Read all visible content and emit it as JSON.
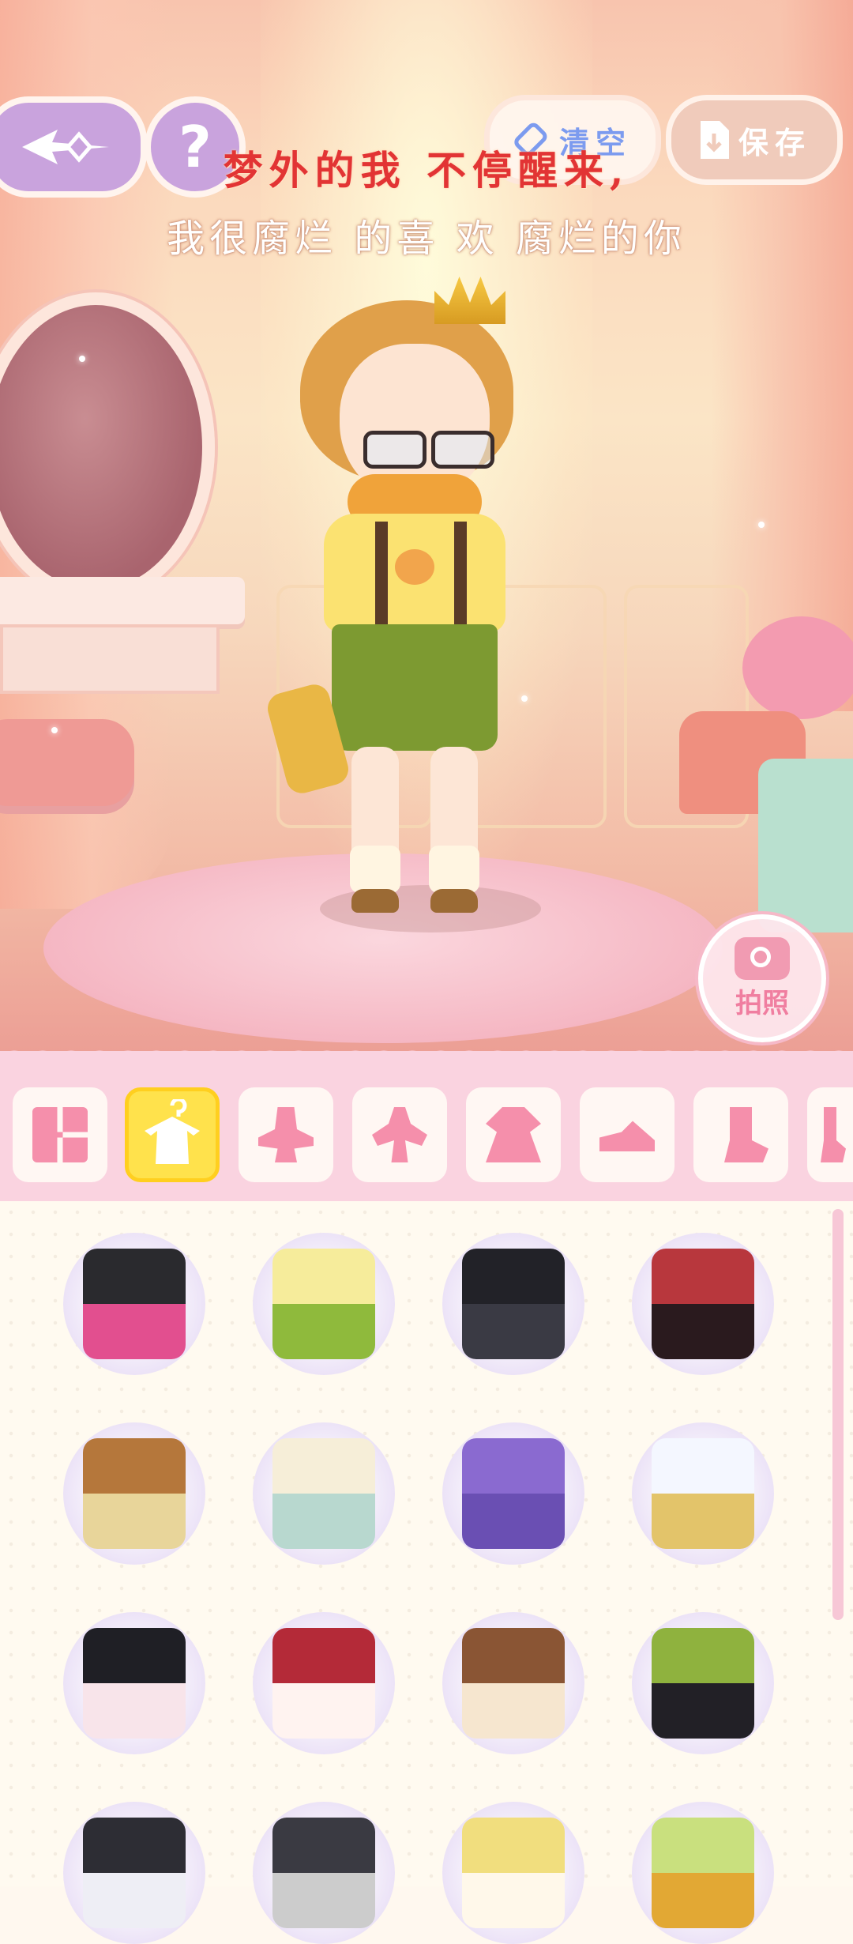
{
  "top_bar": {
    "clear_label": "清空",
    "save_label": "保存",
    "back_icon": "back-arrow-icon",
    "help_icon": "question-icon",
    "help_glyph": "?"
  },
  "lyrics": {
    "line1": "梦外的我 不停醒来,",
    "line2": "我很腐烂 的喜 欢 腐烂的你"
  },
  "photo_button": {
    "label": "拍照",
    "icon": "camera-icon"
  },
  "tabs": [
    {
      "name": "all",
      "icon": "grid-icon",
      "active": false
    },
    {
      "name": "outfit",
      "icon": "outfit-icon",
      "active": true
    },
    {
      "name": "headwear",
      "icon": "hat-icon",
      "active": false
    },
    {
      "name": "top",
      "icon": "top-icon",
      "active": false
    },
    {
      "name": "dress",
      "icon": "dress-icon",
      "active": false
    },
    {
      "name": "shoes",
      "icon": "shoe-icon",
      "active": false
    },
    {
      "name": "socks",
      "icon": "sock-icon",
      "active": false
    },
    {
      "name": "more",
      "icon": "glove-icon",
      "active": false
    }
  ],
  "outfits": [
    {
      "name": "black-pink-checker-outfit",
      "colors": [
        "#2a2a2e",
        "#e24f8f"
      ]
    },
    {
      "name": "yellow-green-checker-outfit",
      "colors": [
        "#f6ec9b",
        "#8fba3c"
      ]
    },
    {
      "name": "black-double-breasted-coat",
      "colors": [
        "#222228",
        "#3a3a44"
      ]
    },
    {
      "name": "vampire-red-vest-outfit",
      "colors": [
        "#b8373d",
        "#2a1a1e"
      ]
    },
    {
      "name": "brown-bear-onesie",
      "colors": [
        "#b5773b",
        "#e8d59a"
      ]
    },
    {
      "name": "cream-qipao-top",
      "colors": [
        "#f6eed8",
        "#b8d8cf"
      ]
    },
    {
      "name": "purple-suit",
      "colors": [
        "#8a6ad0",
        "#6a4fb3"
      ]
    },
    {
      "name": "white-cape-gown",
      "colors": [
        "#f4f7ff",
        "#e3c46a"
      ]
    },
    {
      "name": "black-lolita-dress",
      "colors": [
        "#1f1f25",
        "#f8e4ea"
      ]
    },
    {
      "name": "red-pinafore-dress",
      "colors": [
        "#b42a38",
        "#fff3f0"
      ]
    },
    {
      "name": "brown-checker-dress",
      "colors": [
        "#8a5534",
        "#f6e6cf"
      ]
    },
    {
      "name": "green-checker-dress",
      "colors": [
        "#8fb23e",
        "#222026"
      ]
    },
    {
      "name": "black-vest-outfit",
      "colors": [
        "#2d2d34",
        "#eeeef5"
      ]
    },
    {
      "name": "dark-gray-coat",
      "colors": [
        "#3a3a42",
        "#cccccc"
      ]
    },
    {
      "name": "yellow-vest-outfit",
      "colors": [
        "#f1de7e",
        "#fff8ea"
      ]
    },
    {
      "name": "yellow-check-bow-outfit",
      "colors": [
        "#c9e07e",
        "#e2a834"
      ]
    }
  ]
}
